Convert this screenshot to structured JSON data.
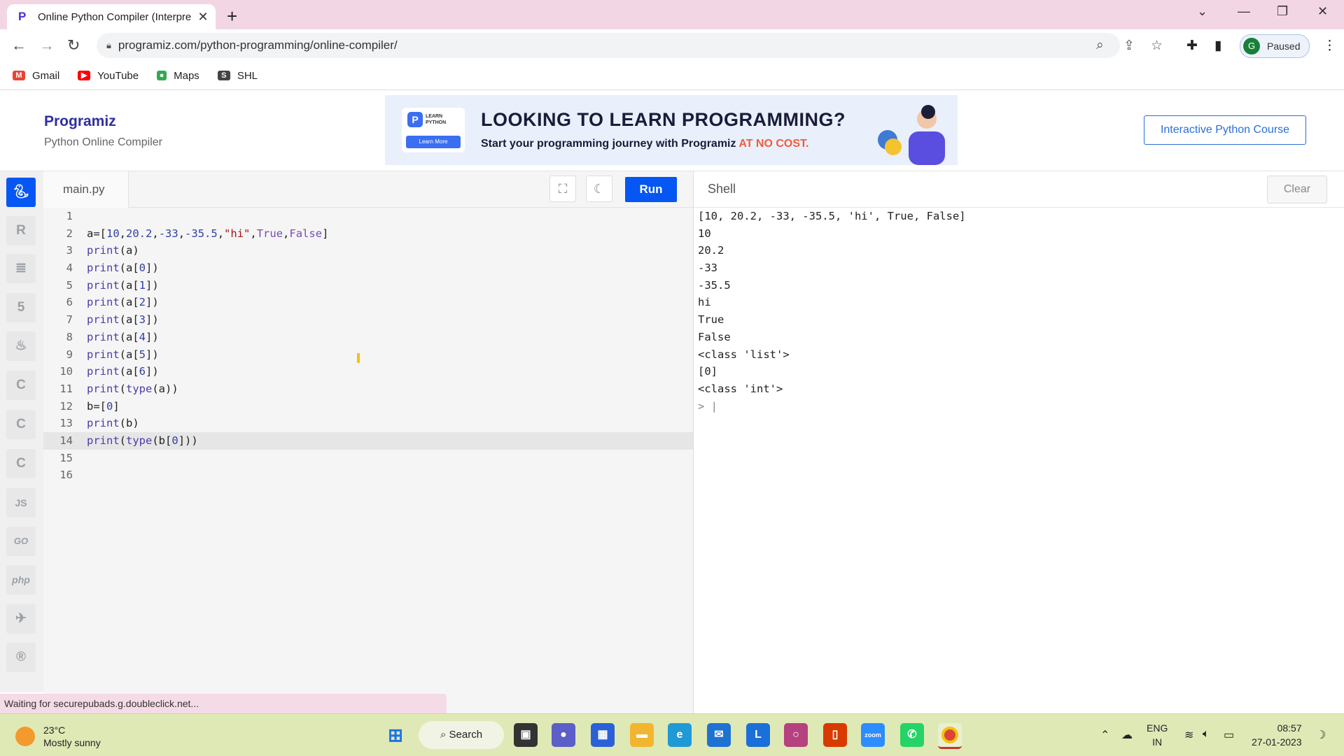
{
  "browser": {
    "tab_title": "Online Python Compiler (Interpre",
    "url": "programiz.com/python-programming/online-compiler/",
    "profile_initial": "G",
    "profile_status": "Paused",
    "bookmarks": [
      {
        "label": "Gmail",
        "icon": "gmail-icon",
        "color": "#ea4335"
      },
      {
        "label": "YouTube",
        "icon": "youtube-icon",
        "color": "#ff0000"
      },
      {
        "label": "Maps",
        "icon": "maps-icon",
        "color": "#34a853"
      },
      {
        "label": "SHL",
        "icon": "shl-icon",
        "color": "#444444"
      }
    ]
  },
  "site": {
    "logo": "Programiz",
    "subtitle": "Python Online Compiler",
    "banner": {
      "badge_line1": "LEARN",
      "badge_line2": "PYTHON",
      "badge_button": "Learn More",
      "headline": "LOOKING TO LEARN PROGRAMMING?",
      "sub_prefix": "Start your programming journey with Programiz ",
      "sub_highlight": "AT NO COST."
    },
    "course_button": "Interactive Python Course"
  },
  "sidebar": {
    "items": [
      {
        "name": "python",
        "icon": "python-icon",
        "label": "Py"
      },
      {
        "name": "r",
        "icon": "r-icon",
        "label": "R"
      },
      {
        "name": "sql",
        "icon": "database-icon",
        "label": "≣"
      },
      {
        "name": "html",
        "icon": "html5-icon",
        "label": "5"
      },
      {
        "name": "java",
        "icon": "java-icon",
        "label": "♨"
      },
      {
        "name": "c",
        "icon": "c-icon",
        "label": "C"
      },
      {
        "name": "cpp",
        "icon": "cpp-icon",
        "label": "C"
      },
      {
        "name": "csharp",
        "icon": "csharp-icon",
        "label": "C"
      },
      {
        "name": "js",
        "icon": "js-icon",
        "label": "JS"
      },
      {
        "name": "go",
        "icon": "go-icon",
        "label": "GO"
      },
      {
        "name": "php",
        "icon": "php-icon",
        "label": "php"
      },
      {
        "name": "swift",
        "icon": "swift-icon",
        "label": "✈"
      },
      {
        "name": "rust",
        "icon": "rust-icon",
        "label": "R"
      }
    ]
  },
  "editor": {
    "filename": "main.py",
    "run_label": "Run",
    "lines": [
      "",
      "a=[10,20.2,-33,-35.5,\"hi\",True,False]",
      "print(a)",
      "print(a[0])",
      "print(a[1])",
      "print(a[2])",
      "print(a[3])",
      "print(a[4])",
      "print(a[5])",
      "print(a[6])",
      "print(type(a))",
      "b=[0]",
      "print(b)",
      "print(type(b[0]))",
      "",
      ""
    ],
    "current_line": 14
  },
  "shell": {
    "title": "Shell",
    "clear_label": "Clear",
    "output": [
      "[10, 20.2, -33, -35.5, 'hi', True, False]",
      "10",
      "20.2",
      "-33",
      "-35.5",
      "hi",
      "True",
      "False",
      "<class 'list'>",
      "[0]",
      "<class 'int'>"
    ],
    "prompt": ">"
  },
  "status": "Waiting for securepubads.g.doubleclick.net...",
  "taskbar": {
    "temperature": "23°C",
    "weather": "Mostly sunny",
    "search_label": "Search",
    "lang1": "ENG",
    "lang2": "IN",
    "time": "08:57",
    "date": "27-01-2023"
  }
}
